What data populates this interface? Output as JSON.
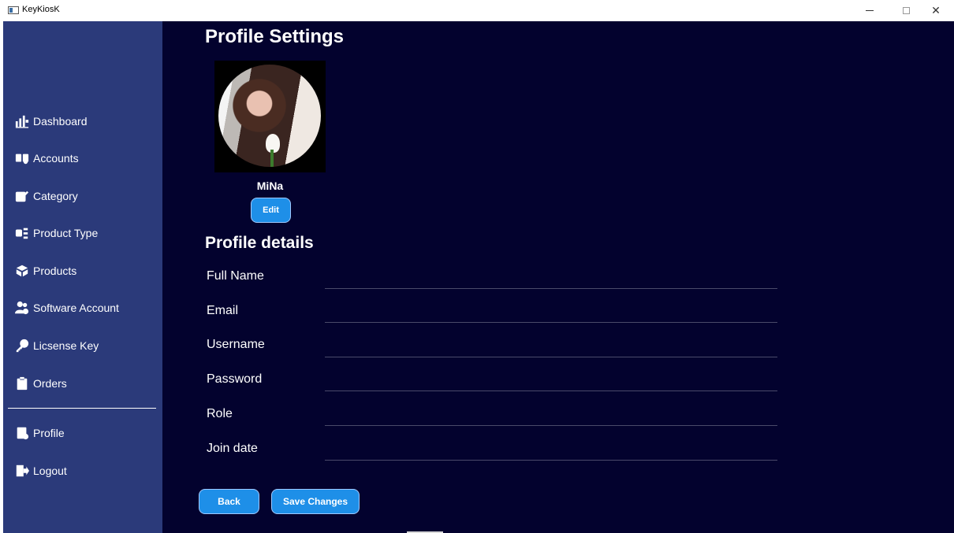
{
  "window": {
    "title": "KeyKiosK",
    "minimize_glyph": "",
    "maximize_glyph": "",
    "close_glyph": "✕"
  },
  "sidebar": {
    "items": [
      {
        "label": "Dashboard",
        "icon": "dashboard-icon"
      },
      {
        "label": "Accounts",
        "icon": "accounts-icon"
      },
      {
        "label": "Category",
        "icon": "edit-icon"
      },
      {
        "label": "Product Type",
        "icon": "product-type-icon"
      },
      {
        "label": "Products",
        "icon": "box-icon"
      },
      {
        "label": "Software Account",
        "icon": "users-icon"
      },
      {
        "label": "Licsense Key",
        "icon": "key-icon"
      },
      {
        "label": "Orders",
        "icon": "clipboard-icon"
      }
    ],
    "bottom_items": [
      {
        "label": "Profile",
        "icon": "profile-icon"
      },
      {
        "label": "Logout",
        "icon": "logout-icon"
      }
    ]
  },
  "main": {
    "title": "Profile Settings",
    "user": {
      "name": "MiNa",
      "edit_label": "Edit"
    },
    "details_title": "Profile details",
    "fields": [
      {
        "label": "Full Name",
        "value": ""
      },
      {
        "label": "Email",
        "value": ""
      },
      {
        "label": "Username",
        "value": ""
      },
      {
        "label": "Password",
        "value": ""
      },
      {
        "label": "Role",
        "value": ""
      },
      {
        "label": "Join date",
        "value": ""
      }
    ],
    "back_label": "Back",
    "save_label": "Save Changes"
  },
  "colors": {
    "sidebar": "#2b3a7a",
    "main_bg": "#03022e",
    "button": "#1e8fe8",
    "text": "#ffffff"
  }
}
